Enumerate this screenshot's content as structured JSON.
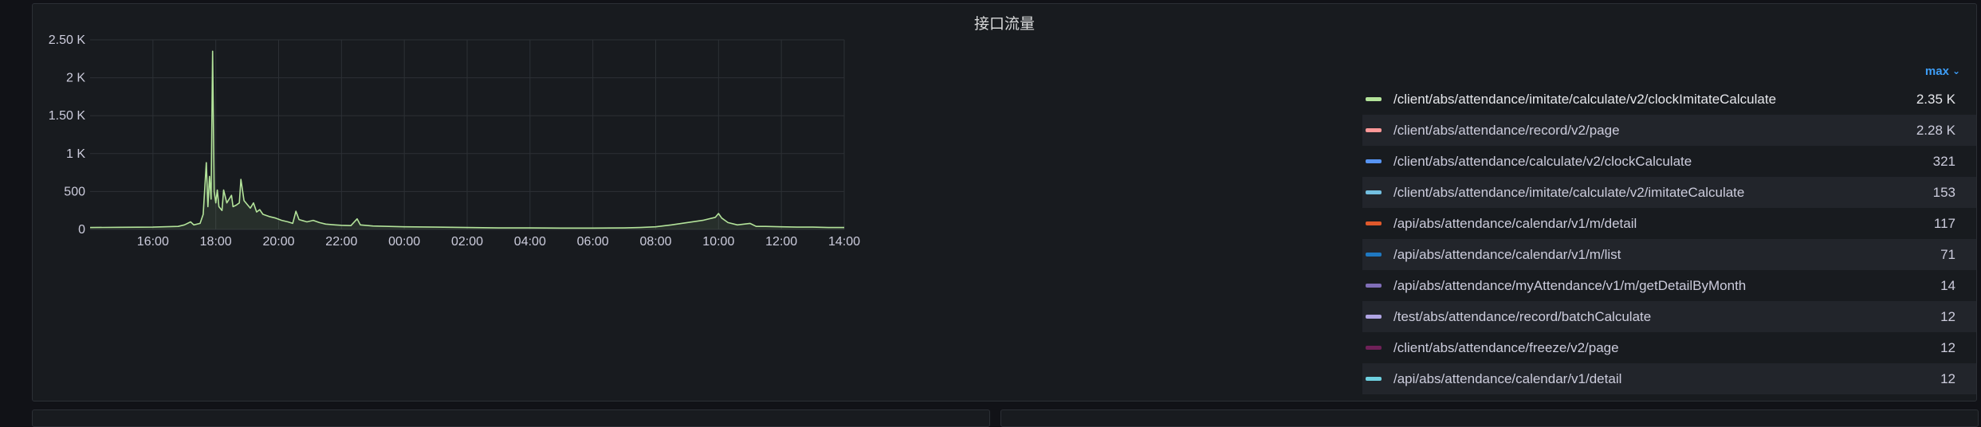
{
  "panel": {
    "title": "接口流量"
  },
  "legend": {
    "sort_label": "max",
    "sort_icon": "chevron-down-icon"
  },
  "colors": {
    "grid": "#2c3035",
    "axis_text": "#ccccdc",
    "main_series": "#b3e39a"
  },
  "chart_data": {
    "type": "line",
    "title": "接口流量",
    "x_ticks": [
      "16:00",
      "18:00",
      "20:00",
      "22:00",
      "00:00",
      "02:00",
      "04:00",
      "06:00",
      "08:00",
      "10:00",
      "12:00",
      "14:00"
    ],
    "y_ticks": [
      "0",
      "500",
      "1 K",
      "1.50 K",
      "2 K",
      "2.50 K"
    ],
    "ylim": [
      0,
      2500
    ],
    "xlim_hours": [
      14.0,
      38.0
    ],
    "grid": true,
    "legend_placement": "right",
    "series": [
      {
        "name": "/client/abs/attendance/imitate/calculate/v2/clockImitateCalculate",
        "max": "2.35 K",
        "color": "#b3e39a",
        "points": [
          [
            14.0,
            25
          ],
          [
            15.0,
            28
          ],
          [
            16.0,
            30
          ],
          [
            16.8,
            40
          ],
          [
            17.0,
            60
          ],
          [
            17.2,
            100
          ],
          [
            17.3,
            60
          ],
          [
            17.5,
            80
          ],
          [
            17.6,
            200
          ],
          [
            17.7,
            880
          ],
          [
            17.75,
            300
          ],
          [
            17.8,
            700
          ],
          [
            17.85,
            400
          ],
          [
            17.9,
            2350
          ],
          [
            17.95,
            500
          ],
          [
            18.0,
            350
          ],
          [
            18.05,
            520
          ],
          [
            18.1,
            300
          ],
          [
            18.2,
            250
          ],
          [
            18.25,
            520
          ],
          [
            18.35,
            350
          ],
          [
            18.5,
            450
          ],
          [
            18.55,
            300
          ],
          [
            18.65,
            320
          ],
          [
            18.75,
            350
          ],
          [
            18.8,
            660
          ],
          [
            18.9,
            380
          ],
          [
            19.0,
            330
          ],
          [
            19.1,
            280
          ],
          [
            19.2,
            350
          ],
          [
            19.3,
            230
          ],
          [
            19.4,
            260
          ],
          [
            19.5,
            200
          ],
          [
            19.7,
            170
          ],
          [
            19.9,
            150
          ],
          [
            20.1,
            120
          ],
          [
            20.3,
            100
          ],
          [
            20.45,
            80
          ],
          [
            20.55,
            240
          ],
          [
            20.65,
            130
          ],
          [
            20.9,
            100
          ],
          [
            21.1,
            120
          ],
          [
            21.3,
            90
          ],
          [
            21.5,
            70
          ],
          [
            21.8,
            60
          ],
          [
            22.0,
            55
          ],
          [
            22.3,
            50
          ],
          [
            22.5,
            140
          ],
          [
            22.6,
            60
          ],
          [
            23.0,
            45
          ],
          [
            23.5,
            40
          ],
          [
            24.0,
            35
          ],
          [
            25.0,
            30
          ],
          [
            26.0,
            25
          ],
          [
            27.0,
            20
          ],
          [
            28.0,
            20
          ],
          [
            29.0,
            18
          ],
          [
            30.0,
            18
          ],
          [
            31.0,
            20
          ],
          [
            31.5,
            25
          ],
          [
            32.0,
            35
          ],
          [
            32.5,
            60
          ],
          [
            33.0,
            90
          ],
          [
            33.5,
            120
          ],
          [
            33.9,
            160
          ],
          [
            34.0,
            210
          ],
          [
            34.1,
            150
          ],
          [
            34.3,
            90
          ],
          [
            34.6,
            60
          ],
          [
            35.0,
            80
          ],
          [
            35.2,
            40
          ],
          [
            35.5,
            40
          ],
          [
            36.0,
            35
          ],
          [
            36.5,
            30
          ],
          [
            37.0,
            30
          ],
          [
            37.5,
            25
          ],
          [
            38.0,
            25
          ]
        ]
      },
      {
        "name": "/client/abs/attendance/record/v2/page",
        "max": "2.28 K",
        "color": "#ff9898"
      },
      {
        "name": "/client/abs/attendance/calculate/v2/clockCalculate",
        "max": "321",
        "color": "#5794f2"
      },
      {
        "name": "/client/abs/attendance/imitate/calculate/v2/imitateCalculate",
        "max": "153",
        "color": "#73bfe0"
      },
      {
        "name": "/api/abs/attendance/calendar/v1/m/detail",
        "max": "117",
        "color": "#e0592b"
      },
      {
        "name": "/api/abs/attendance/calendar/v1/m/list",
        "max": "71",
        "color": "#1f78c1"
      },
      {
        "name": "/api/abs/attendance/myAttendance/v1/m/getDetailByMonth",
        "max": "14",
        "color": "#806eb7"
      },
      {
        "name": "/test/abs/attendance/record/batchCalculate",
        "max": "12",
        "color": "#b0a4e3"
      },
      {
        "name": "/client/abs/attendance/freeze/v2/page",
        "max": "12",
        "color": "#6f2158"
      },
      {
        "name": "/api/abs/attendance/calendar/v1/detail",
        "max": "12",
        "color": "#6ed0e0"
      }
    ]
  }
}
